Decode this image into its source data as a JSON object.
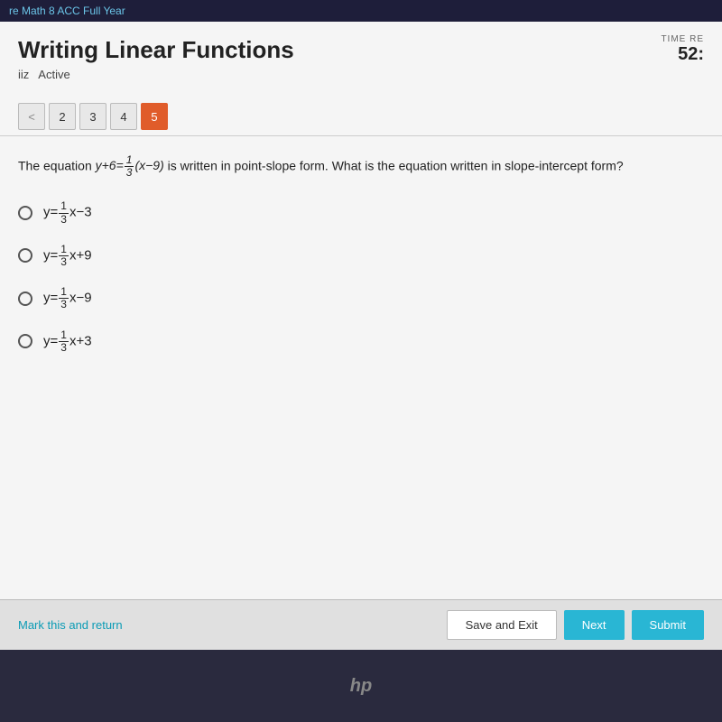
{
  "topbar": {
    "course_name": "re Math 8 ACC Full Year"
  },
  "header": {
    "title": "Writing Linear Functions",
    "quiz_label": "iiz",
    "status_label": "Active"
  },
  "timer": {
    "label": "TIME RE",
    "value": "52:"
  },
  "question_nav": {
    "buttons": [
      {
        "label": "<",
        "state": "prev"
      },
      {
        "label": "2",
        "state": "normal"
      },
      {
        "label": "3",
        "state": "normal"
      },
      {
        "label": "4",
        "state": "normal"
      },
      {
        "label": "5",
        "state": "active"
      }
    ]
  },
  "question": {
    "text_prefix": "The equation ",
    "equation": "y+6=⅓(x−9)",
    "text_suffix": " is written in point-slope form. What is the equation written in slope-intercept form?",
    "options": [
      {
        "id": "a",
        "label": "y=⅓x−3"
      },
      {
        "id": "b",
        "label": "y=⅓x+9"
      },
      {
        "id": "c",
        "label": "y=⅓x−9"
      },
      {
        "id": "d",
        "label": "y=⅓x+3"
      }
    ]
  },
  "footer": {
    "mark_return_label": "Mark this and return",
    "save_exit_label": "Save and Exit",
    "next_label": "Next",
    "submit_label": "Submit"
  },
  "laptop": {
    "logo": "hp"
  }
}
